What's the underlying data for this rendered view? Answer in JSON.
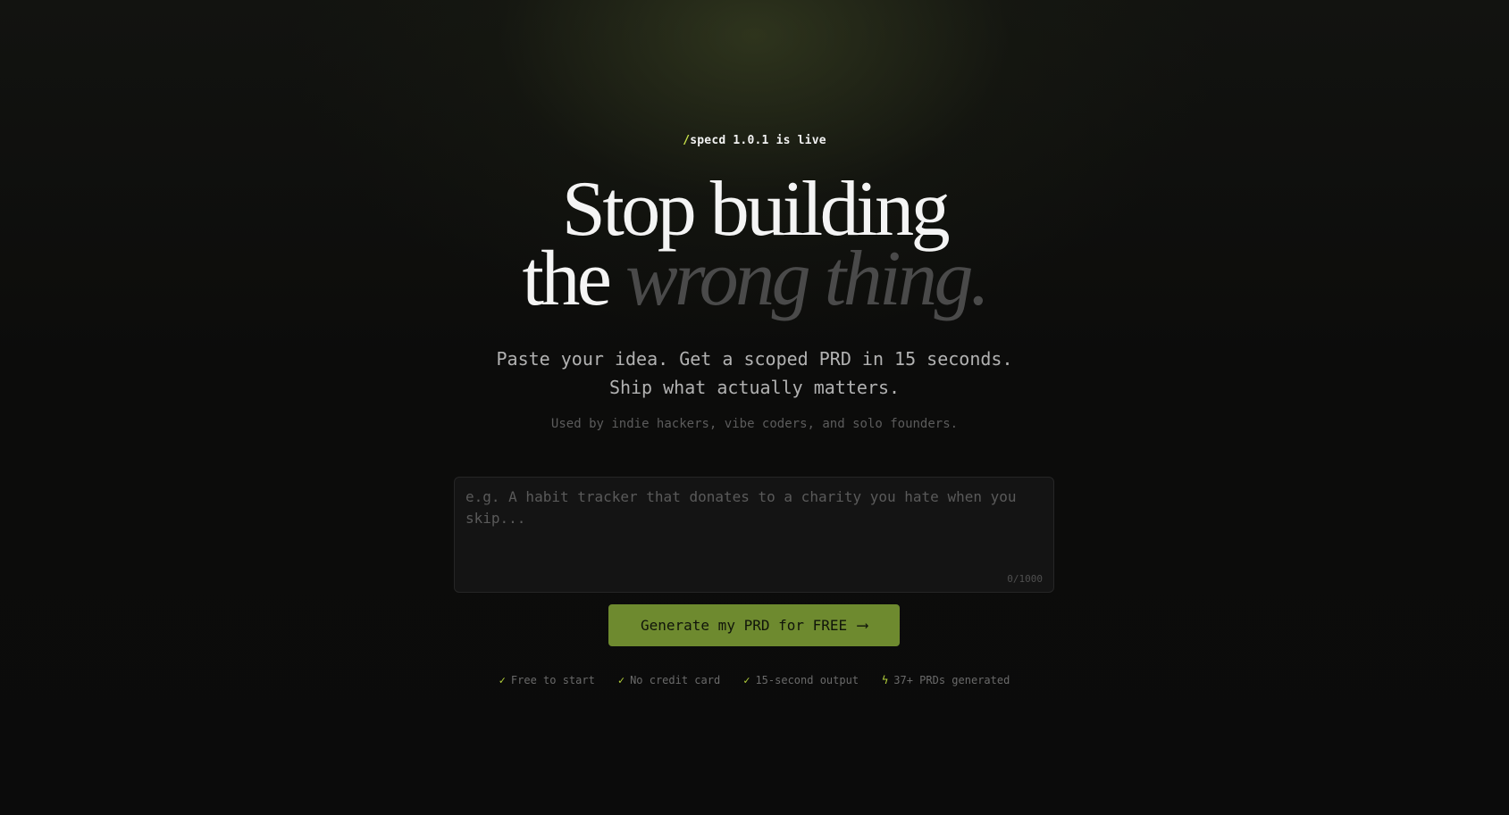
{
  "badge": {
    "slash": "/",
    "text": "specd 1.0.1 is live"
  },
  "headline": {
    "line1": "Stop building",
    "line2_plain": "the ",
    "line2_emphasis": "wrong thing."
  },
  "subheadline": {
    "line1": "Paste your idea. Get a scoped PRD in 15 seconds.",
    "line2": "Ship what actually matters."
  },
  "social_proof": "Used by indie hackers, vibe coders, and solo founders.",
  "idea_input": {
    "placeholder": "e.g. A habit tracker that donates to a charity you hate when you skip...",
    "value": "",
    "counter": "0/1000"
  },
  "cta": {
    "label": "Generate my PRD for FREE",
    "arrow": "⟶"
  },
  "perks": [
    {
      "icon": "check-icon",
      "glyph": "✓",
      "label": "Free to start"
    },
    {
      "icon": "check-icon",
      "glyph": "✓",
      "label": "No credit card"
    },
    {
      "icon": "check-icon",
      "glyph": "✓",
      "label": "15-second output"
    },
    {
      "icon": "lightning-icon",
      "glyph": "ϟ",
      "label": "37+ PRDs generated"
    }
  ],
  "colors": {
    "background": "#0b0b0b",
    "accent": "#c8e34a",
    "cta_background": "#6e8a2f",
    "muted_text": "#4a4a4a"
  }
}
